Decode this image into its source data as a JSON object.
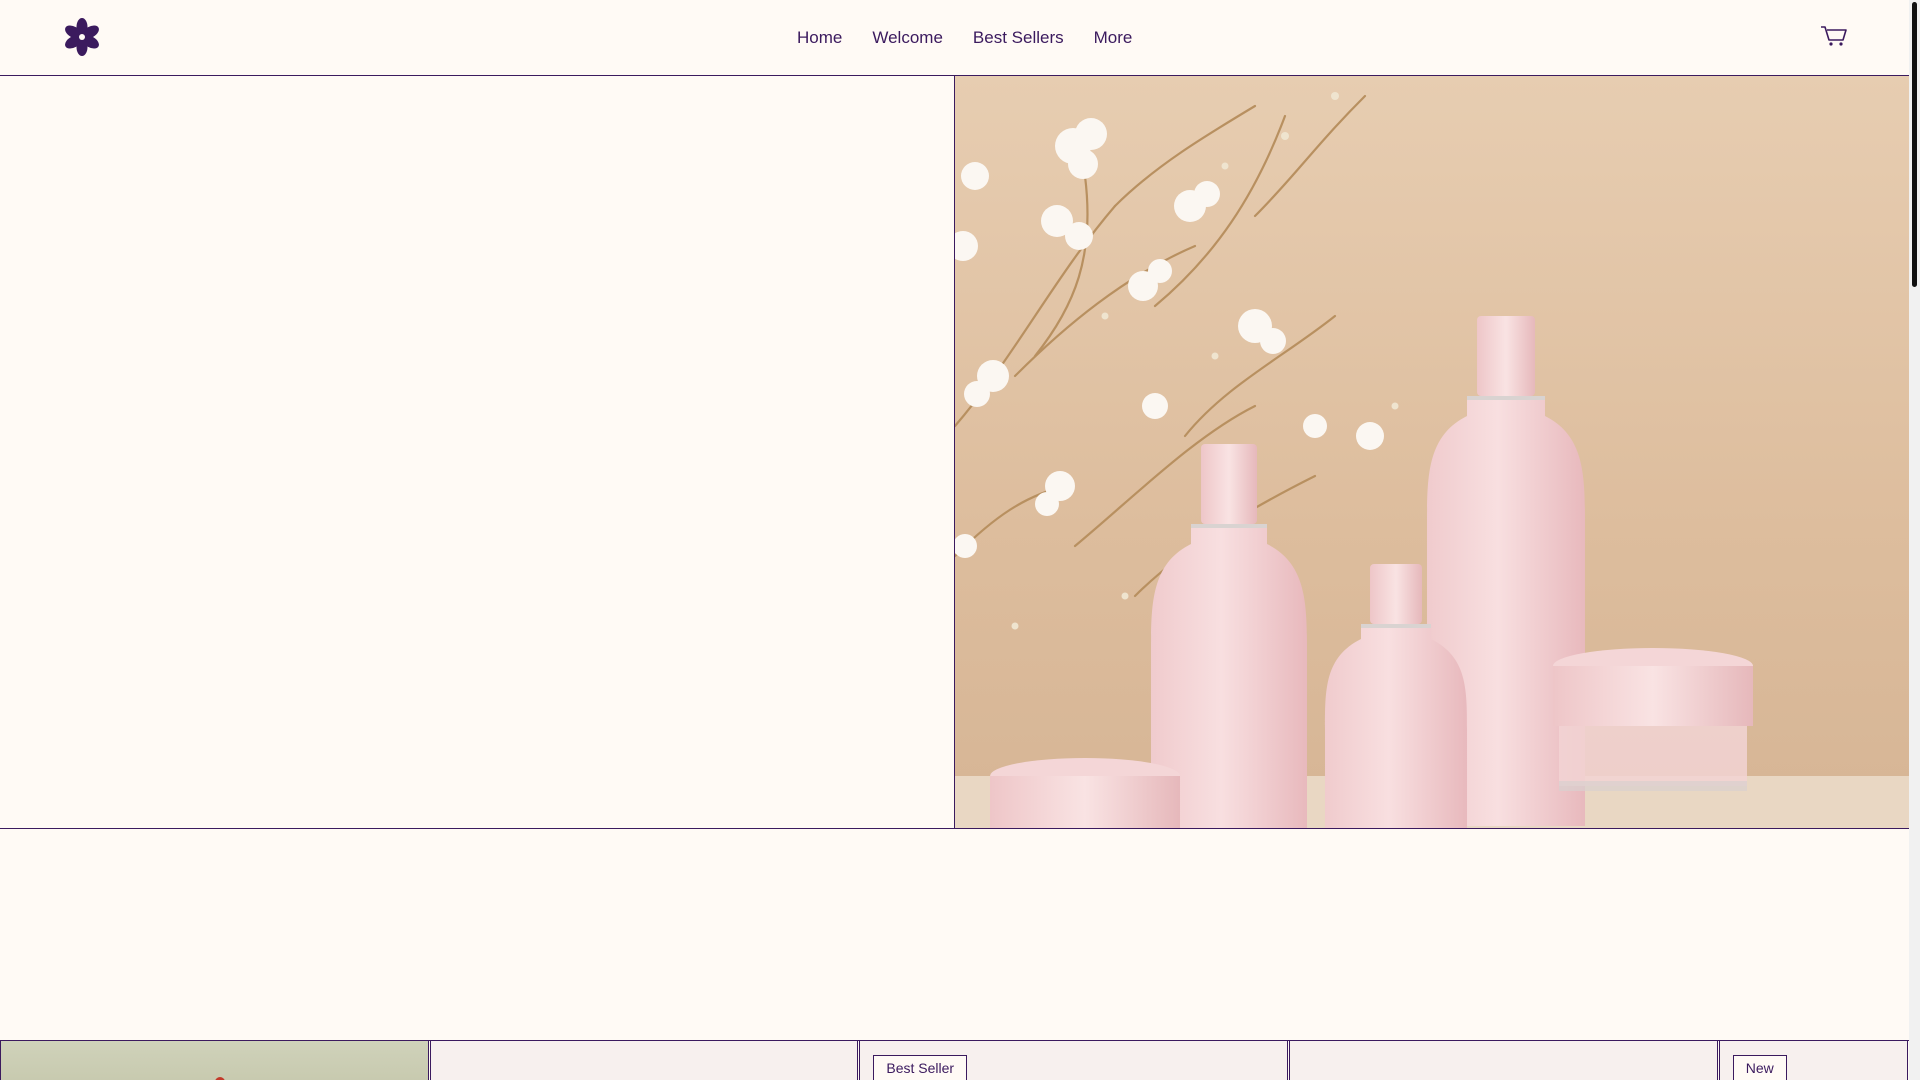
{
  "logo": {
    "icon": "flower-logo-icon"
  },
  "nav": {
    "items": [
      {
        "label": "Home"
      },
      {
        "label": "Welcome"
      },
      {
        "label": "Best Sellers"
      },
      {
        "label": "More"
      }
    ]
  },
  "cart": {
    "icon": "cart-icon"
  },
  "products": {
    "cards": [
      {
        "badge": ""
      },
      {
        "badge": ""
      },
      {
        "badge": "Best Seller"
      },
      {
        "badge": ""
      },
      {
        "badge": "New"
      }
    ]
  },
  "colors": {
    "brand": "#3b1a5e",
    "background": "#fffaf5",
    "hero_bg": "#e1c5a8"
  }
}
